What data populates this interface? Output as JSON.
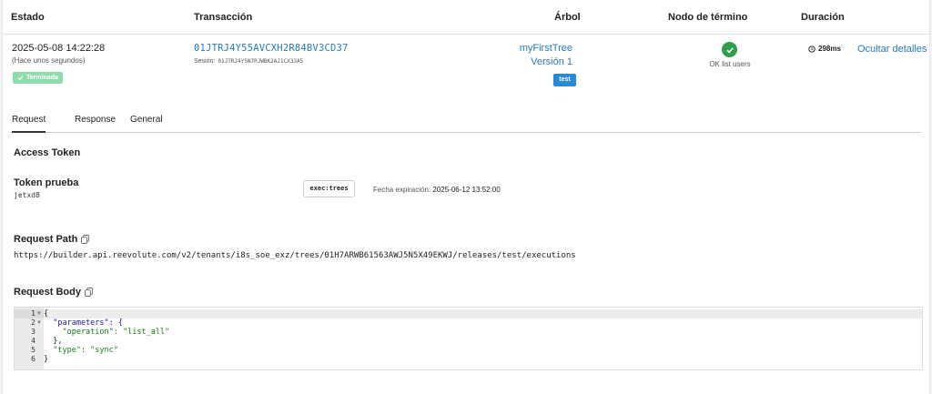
{
  "table": {
    "headers": {
      "estado": "Estado",
      "transaccion": "Transacción",
      "arbol": "Árbol",
      "nodo": "Nodo de término",
      "duracion": "Duración"
    },
    "row": {
      "date": "2025-05-08 14:22:28",
      "relative": "(Hace unos segundos)",
      "status": "Terminada",
      "transaction_id": "01JTRJ4Y55AVCXH2R84BV3CD37",
      "session_label": "Sesión:",
      "session_id": "01JTRJ4Y5N7RJWBK2AJ1CX33A5",
      "tree_name": "myFirstTree",
      "tree_version": "Versión 1",
      "environment": "test",
      "end_node": "OK list users",
      "duration": "298ms",
      "hide_details": "Ocultar detalles"
    }
  },
  "tabs": [
    "Request",
    "Response",
    "General"
  ],
  "request": {
    "access_token_title": "Access Token",
    "token_name": "Token prueba",
    "token_value": "jetxd8",
    "scope": "exec:trees",
    "expiry_label": "Fecha expiración:",
    "expiry_value": "2025-06-12 13:52:00",
    "path_title": "Request Path",
    "path": "https://builder.api.reevolute.com/v2/tenants/i8s_soe_exz/trees/01H7ARWB61563AWJ5N5X49EKWJ/releases/test/executions",
    "body_title": "Request Body",
    "body_lines": [
      "{",
      "  \"parameters\": {",
      "    \"operation\": \"list_all\"",
      "  },",
      "  \"type\": \"sync\"",
      "}"
    ],
    "line_numbers": [
      "1",
      "2",
      "3",
      "4",
      "5",
      "6"
    ]
  },
  "colors": {
    "link": "#2a7ab8",
    "success_badge": "#8fdbb0",
    "ok_icon": "#2e9e4a",
    "env_badge": "#2b8ad6"
  }
}
